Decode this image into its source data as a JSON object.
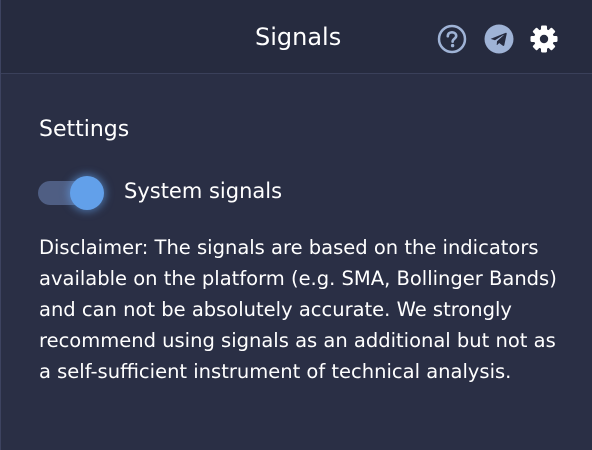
{
  "header": {
    "title": "Signals",
    "icons": [
      "help-circle-icon",
      "telegram-icon",
      "gear-icon"
    ]
  },
  "settings": {
    "title": "Settings",
    "toggle": {
      "label": "System signals",
      "on": true,
      "accent_color": "#62a0ea"
    },
    "disclaimer": "Disclaimer: The signals are based on the indicators available on the platform (e.g. SMA, Bollinger Bands) and can not be absolutely accurate. We strongly recommend using signals as an additional but not as a self-sufficient instrument of technical analysis."
  },
  "colors": {
    "background": "#2a2f45",
    "header_background": "#262b3f",
    "icon_color": "#9fb3d6"
  }
}
